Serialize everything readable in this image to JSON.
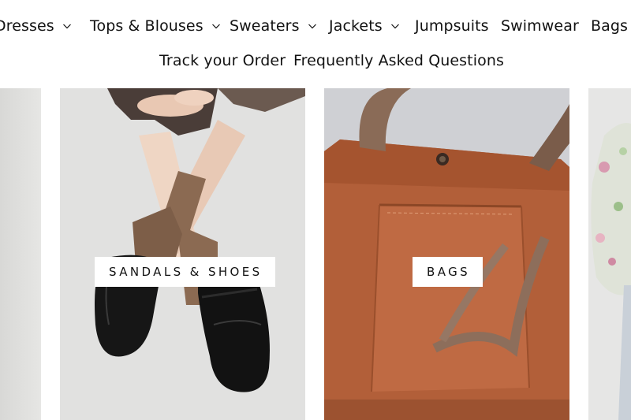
{
  "nav": {
    "row1": [
      {
        "label": "Dresses",
        "has_dropdown": true
      },
      {
        "label": "Tops & Blouses",
        "has_dropdown": true
      },
      {
        "label": "Sweaters",
        "has_dropdown": true
      },
      {
        "label": "Jackets",
        "has_dropdown": true
      },
      {
        "label": "Jumpsuits",
        "has_dropdown": false
      },
      {
        "label": "Swimwear",
        "has_dropdown": false
      },
      {
        "label": "Bags",
        "has_dropdown": false
      }
    ],
    "row2": [
      {
        "label": "Track your Order"
      },
      {
        "label": "Frequently Asked Questions"
      }
    ]
  },
  "collections": [
    {
      "label": "Sandals & Shoes"
    },
    {
      "label": "Bags"
    }
  ],
  "colors": {
    "text": "#121212",
    "background": "#ffffff",
    "leather": "#b8623a"
  }
}
